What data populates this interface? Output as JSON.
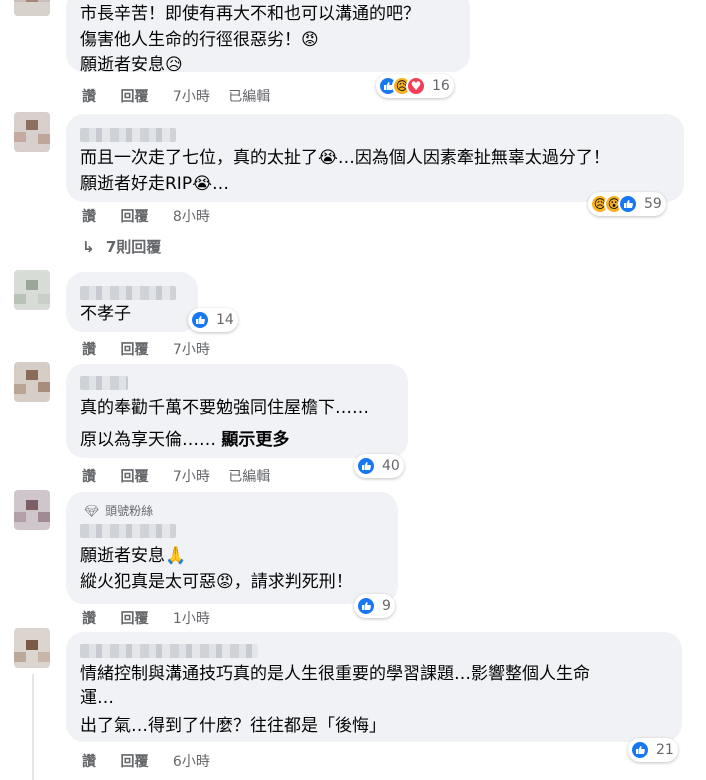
{
  "ui": {
    "reply": "回覆",
    "like": "讚",
    "edited": "已編輯"
  },
  "comments": [
    {
      "lines": [
        "市長辛苦！即使有再大不和也可以溝通的吧？",
        "傷害他人生命的行徑很惡劣！😡",
        "願逝者安息😥"
      ],
      "time": "7小時",
      "edited": true,
      "reactions": [
        "like",
        "sad",
        "love"
      ],
      "reaction_count": "16"
    },
    {
      "lines": [
        "而且一次走了七位，真的太扯了😭…因為個人因素牽扯無辜太過分了！",
        "願逝者好走RIP😭…"
      ],
      "time": "8小時",
      "edited": false,
      "reactions": [
        "sad",
        "wow",
        "like"
      ],
      "reaction_count": "59",
      "replies_label": "7則回覆"
    },
    {
      "lines": [
        "不孝子"
      ],
      "time": "7小時",
      "edited": false,
      "reactions": [
        "like"
      ],
      "reaction_count": "14"
    },
    {
      "lines": [
        "真的奉勸千萬不要勉強同住屋檐下……",
        "原以為享天倫……"
      ],
      "see_more": "顯示更多",
      "time": "7小時",
      "edited": true,
      "reactions": [
        "like"
      ],
      "reaction_count": "40"
    },
    {
      "badge": "頭號粉絲",
      "lines": [
        "願逝者安息🙏",
        "縱火犯真是太可惡😡，請求判死刑！"
      ],
      "time": "1小時",
      "edited": false,
      "reactions": [
        "like"
      ],
      "reaction_count": "9"
    },
    {
      "lines": [
        "情緒控制與溝通技巧真的是人生很重要的學習課題…影響整個人生命",
        "運…",
        "出了氣…得到了什麼？往往都是「後悔」"
      ],
      "time": "6小時",
      "edited": false,
      "reactions": [
        "like"
      ],
      "reaction_count": "21"
    }
  ],
  "colors": {
    "bubble": "#f0f2f5",
    "meta": "#65676b",
    "like": "#1877f2",
    "love": "#f33e58",
    "sad": "#f7b125"
  }
}
